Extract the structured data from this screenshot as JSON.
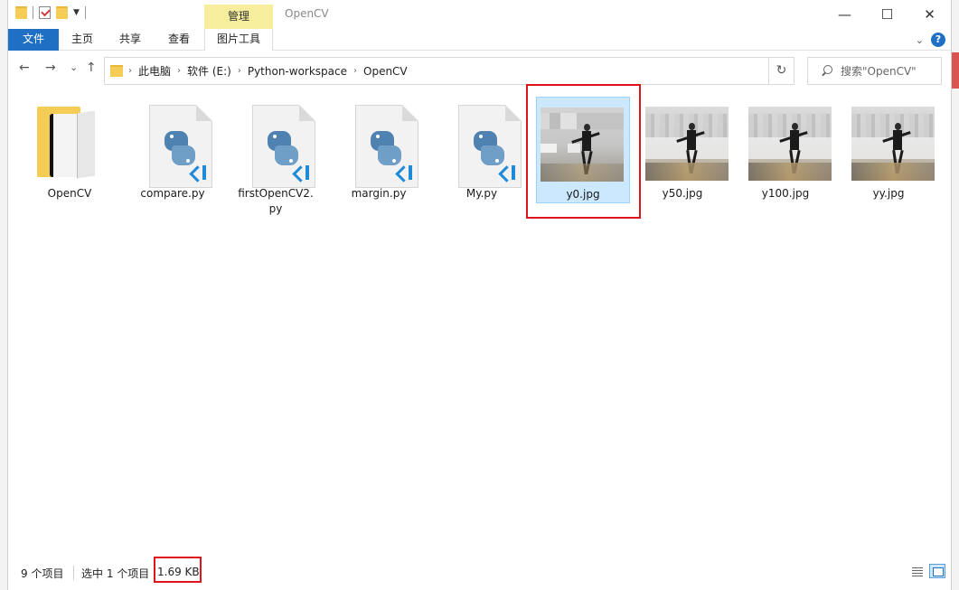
{
  "window": {
    "title": "OpenCV",
    "contextual_tab": "管理",
    "controls": {
      "minimize": "—",
      "maximize": "☐",
      "close": "✕"
    }
  },
  "ribbon": {
    "tabs": [
      "文件",
      "主页",
      "共享",
      "查看",
      "图片工具"
    ],
    "help": "?"
  },
  "nav": {
    "back": "←",
    "forward": "→",
    "recent": "⌄",
    "up": "↑",
    "breadcrumb": [
      "此电脑",
      "软件 (E:)",
      "Python-workspace",
      "OpenCV"
    ],
    "refresh": "↻",
    "search_placeholder": "搜索\"OpenCV\""
  },
  "items": [
    {
      "name": "OpenCV",
      "type": "folder"
    },
    {
      "name": "compare.py",
      "type": "python"
    },
    {
      "name": "firstOpenCV2.py",
      "type": "python"
    },
    {
      "name": "margin.py",
      "type": "python"
    },
    {
      "name": "My.py",
      "type": "python"
    },
    {
      "name": "y0.jpg",
      "type": "image",
      "selected": true
    },
    {
      "name": "y50.jpg",
      "type": "image"
    },
    {
      "name": "y100.jpg",
      "type": "image"
    },
    {
      "name": "yy.jpg",
      "type": "image"
    }
  ],
  "status": {
    "item_count": "9 个项目",
    "selected": "选中 1 个项目",
    "size": "1.69 KB"
  },
  "colors": {
    "accent": "#1f6fc5",
    "selection": "#cce8ff",
    "highlight_box": "#e0141c",
    "context_tab": "#f6ee9c"
  }
}
